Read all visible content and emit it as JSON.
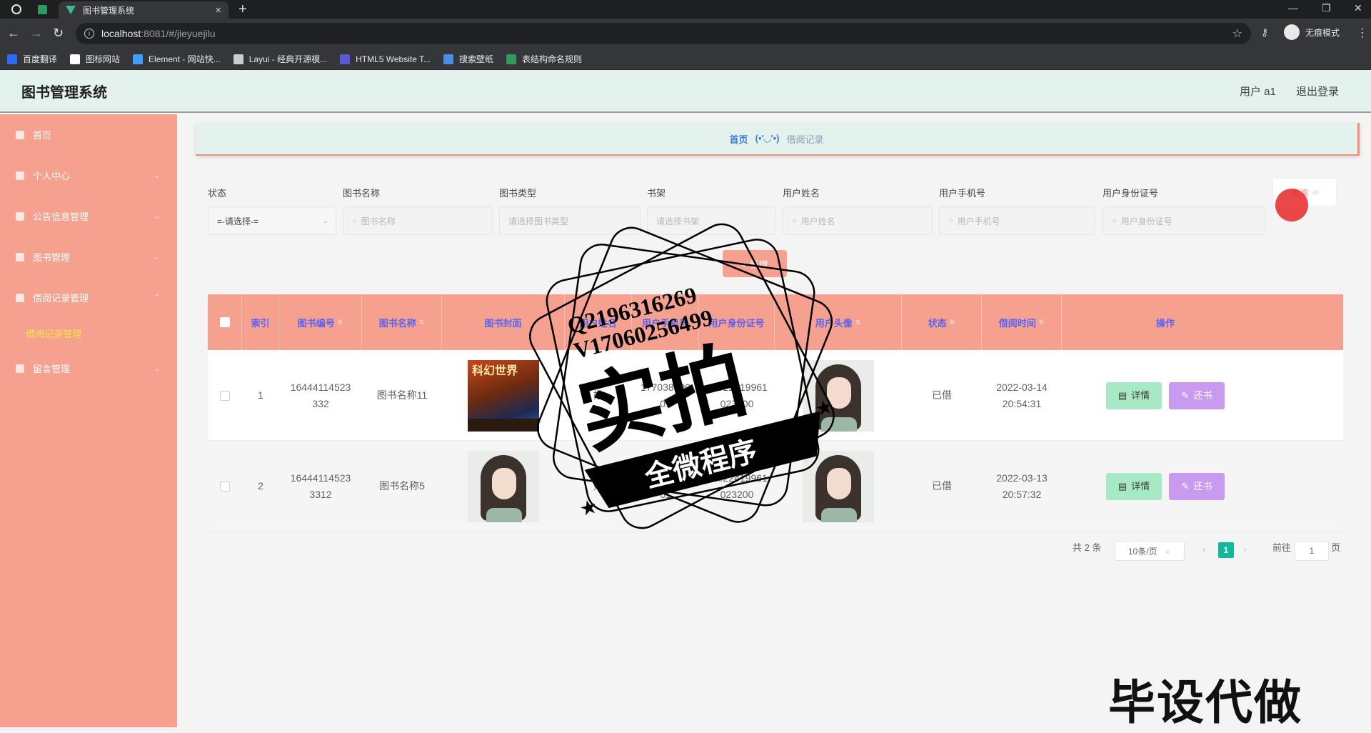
{
  "browser": {
    "tab_title": "图书管理系统",
    "url_host": "localhost",
    "url_path": ":8081/#/jieyuejilu",
    "incognito_label": "无痕模式",
    "bookmarks": [
      {
        "label": "百度翻译",
        "color": "#2a6df4"
      },
      {
        "label": "图标网站",
        "color": "#ffffff"
      },
      {
        "label": "Element - 网站快...",
        "color": "#409eff"
      },
      {
        "label": "Layui - 经典开源模...",
        "color": "#cccccc"
      },
      {
        "label": "HTML5 Website T...",
        "color": "#5b57d6"
      },
      {
        "label": "搜索壁纸",
        "color": "#4a90e2"
      },
      {
        "label": "表结构命名规则",
        "color": "#2e9b5d"
      }
    ]
  },
  "header": {
    "title": "图书管理系统",
    "user": "用户 a1",
    "logout": "退出登录"
  },
  "sidebar": {
    "items": [
      {
        "label": "首页",
        "has_children": false
      },
      {
        "label": "个人中心",
        "has_children": true
      },
      {
        "label": "公告信息管理",
        "has_children": true
      },
      {
        "label": "图书管理",
        "has_children": true
      },
      {
        "label": "借阅记录管理",
        "has_children": true,
        "expanded": true
      },
      {
        "label": "留言管理",
        "has_children": true
      }
    ],
    "active_sub": "借阅记录管理"
  },
  "breadcrumb": {
    "home": "首页",
    "separator": "(•'◡'•)",
    "current": "借阅记录"
  },
  "search": {
    "fields": [
      {
        "label": "状态",
        "value": "=-请选择-="
      },
      {
        "label": "图书名称",
        "placeholder": "图书名称"
      },
      {
        "label": "图书类型",
        "placeholder": "请选择图书类型"
      },
      {
        "label": "书架",
        "placeholder": "请选择书架"
      },
      {
        "label": "用户姓名",
        "placeholder": "用户姓名"
      },
      {
        "label": "用户手机号",
        "placeholder": "用户手机号"
      },
      {
        "label": "用户身份证号",
        "placeholder": "用户身份证号"
      }
    ],
    "query_button": "查询",
    "add_button": "+ 新增"
  },
  "table": {
    "columns": [
      "索引",
      "图书编号",
      "图书名称",
      "图书封面",
      "用户姓名",
      "用户手机号",
      "用户身份证号",
      "用户头像",
      "状态",
      "借阅时间",
      "操作"
    ],
    "rows": [
      {
        "index": "1",
        "book_no": "16444114523332",
        "book_name": "图书名称11",
        "cover": "book",
        "user_name": "姓",
        "phone": "17703890001",
        "id_card": "41022419961023200",
        "avatar": "portrait",
        "status": "已借",
        "time_date": "2022-03-14",
        "time_clock": "20:54:31"
      },
      {
        "index": "2",
        "book_no": "164441145233312",
        "book_name": "图书名称5",
        "cover": "portrait",
        "user_name": "姓",
        "phone": "17703890001",
        "id_card": "41022419961023200",
        "avatar": "portrait",
        "status": "已借",
        "time_date": "2022-03-13",
        "time_clock": "20:57:32"
      }
    ],
    "detail_button": "详情",
    "return_button": "还书"
  },
  "pagination": {
    "total": "共 2 条",
    "page_size": "10条/页",
    "current_page": "1",
    "goto_label": "前往",
    "goto_value": "1",
    "page_suffix": "页"
  },
  "watermark": {
    "qq": "Q2196316269",
    "v": "V17060256499",
    "big": "实拍",
    "band": "全微程序",
    "corner": "毕设代做"
  }
}
